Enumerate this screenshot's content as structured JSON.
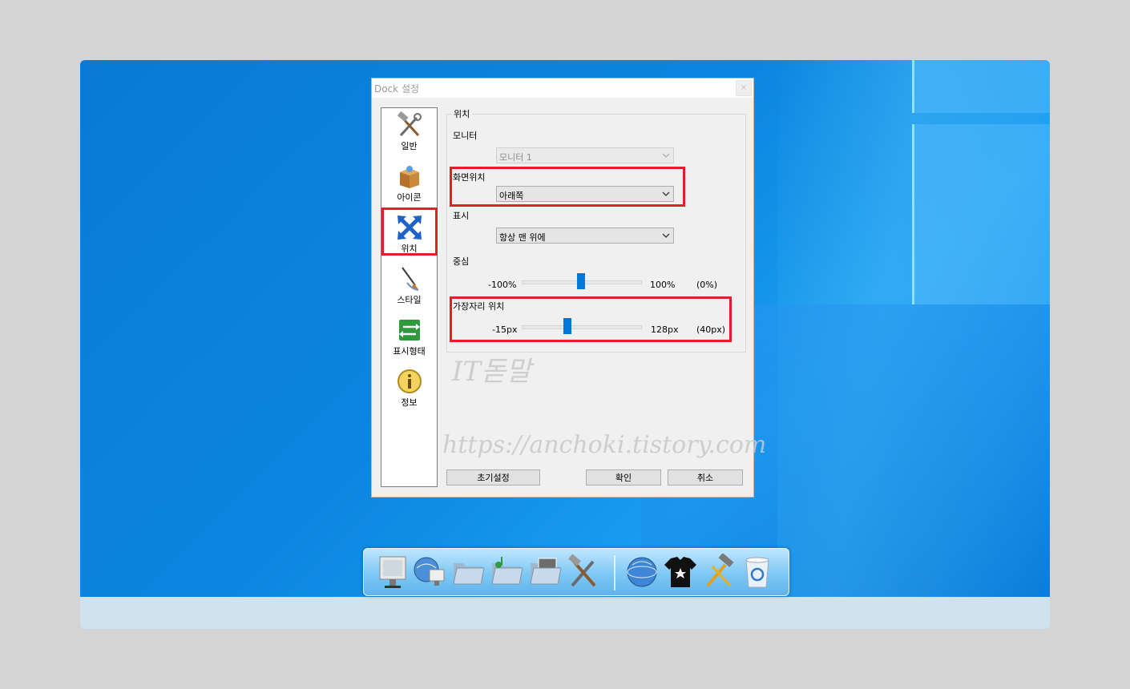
{
  "dialog": {
    "title": "Dock 설정",
    "close": "×"
  },
  "sidebar": {
    "items": [
      {
        "label": "일반",
        "icon": "tools-icon"
      },
      {
        "label": "아이콘",
        "icon": "box-icon"
      },
      {
        "label": "위치",
        "icon": "move-arrows-icon"
      },
      {
        "label": "스타일",
        "icon": "brush-icon"
      },
      {
        "label": "표시형태",
        "icon": "swap-arrows-icon"
      },
      {
        "label": "정보",
        "icon": "info-icon"
      }
    ],
    "selected": "위치"
  },
  "position": {
    "group_label": "위치",
    "monitor_label": "모니터",
    "monitor_value": "모니터 1",
    "screen_position_label": "화면위치",
    "screen_position_value": "아래쪽",
    "display_label": "표시",
    "display_value": "항상 맨 위에",
    "center": {
      "label": "중심",
      "min": "-100%",
      "max": "100%",
      "current": "(0%)",
      "value": 0,
      "range": [
        -100,
        100
      ]
    },
    "edge": {
      "label": "가장자리 위치",
      "min": "-15px",
      "max": "128px",
      "current": "(40px)",
      "value": 40,
      "range": [
        -15,
        128
      ]
    }
  },
  "buttons": {
    "reset": "초기설정",
    "ok": "확인",
    "cancel": "취소"
  },
  "watermark": {
    "line1": "IT돋말",
    "line2": "https://anchoki.tistory.com"
  },
  "dock": {
    "icons": [
      "monitor-icon",
      "network-globe-icon",
      "folder-icon",
      "music-folder-icon",
      "picture-folder-icon",
      "tools-icon",
      "globe-icon",
      "tshirt-icon",
      "hammer-icon",
      "recycle-bin-icon"
    ]
  },
  "colors": {
    "desktop": "#0b86e0",
    "highlight": "#e31e2a",
    "slider_thumb": "#0078d7"
  }
}
